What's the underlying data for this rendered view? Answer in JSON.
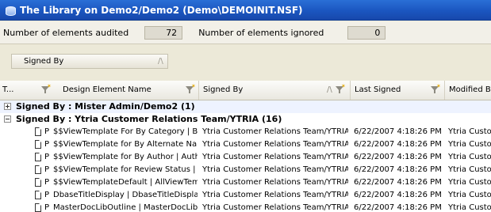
{
  "window": {
    "title": "The Library on Demo2/Demo2 (Demo\\DEMOINIT.NSF)"
  },
  "stats": {
    "audited_label": "Number of elements audited",
    "audited_value": "72",
    "ignored_label": "Number of elements ignored",
    "ignored_value": "0"
  },
  "group_panel": {
    "chip_label": "Signed By",
    "sort_arrow": "/\\"
  },
  "columns": {
    "type": "T...",
    "name": "Design Element Name",
    "signed_by": "Signed By",
    "signed_by_sort": "/\\",
    "last_signed": "Last Signed",
    "modified_by": "Modified By"
  },
  "groups": [
    {
      "label": "Signed By : Mister Admin/Demo2 (1)",
      "expanded": false
    },
    {
      "label": "Signed By : Ytria Customer Relations Team/YTRIA (16)",
      "expanded": true
    }
  ],
  "rows": [
    {
      "type": "P",
      "name": "$$ViewTemplate For By Category | By C...",
      "signed_by": "Ytria Customer Relations Team/YTRIA",
      "last_signed": "6/22/2007 4:18:26 PM",
      "modified_by": "Ytria Custom"
    },
    {
      "type": "P",
      "name": "$$ViewTemplate for By Alternate Name |...",
      "signed_by": "Ytria Customer Relations Team/YTRIA",
      "last_signed": "6/22/2007 4:18:26 PM",
      "modified_by": "Ytria Custom"
    },
    {
      "type": "P",
      "name": "$$ViewTemplate for By Author | AuthorV...",
      "signed_by": "Ytria Customer Relations Team/YTRIA",
      "last_signed": "6/22/2007 4:18:26 PM",
      "modified_by": "Ytria Custom"
    },
    {
      "type": "P",
      "name": "$$ViewTemplate for Review Status | Re...",
      "signed_by": "Ytria Customer Relations Team/YTRIA",
      "last_signed": "6/22/2007 4:18:26 PM",
      "modified_by": "Ytria Custom"
    },
    {
      "type": "P",
      "name": "$$ViewTemplateDefault | AllViewTemplate",
      "signed_by": "Ytria Customer Relations Team/YTRIA",
      "last_signed": "6/22/2007 4:18:26 PM",
      "modified_by": "Ytria Custom"
    },
    {
      "type": "P",
      "name": "DbaseTitleDisplay | DbaseTitleDisplay",
      "signed_by": "Ytria Customer Relations Team/YTRIA",
      "last_signed": "6/22/2007 4:18:26 PM",
      "modified_by": "Ytria Custom"
    },
    {
      "type": "P",
      "name": "MasterDocLibOutline | MasterDocLibOutline",
      "signed_by": "Ytria Customer Relations Team/YTRIA",
      "last_signed": "6/22/2007 4:18:26 PM",
      "modified_by": "Ytria Custom"
    }
  ]
}
